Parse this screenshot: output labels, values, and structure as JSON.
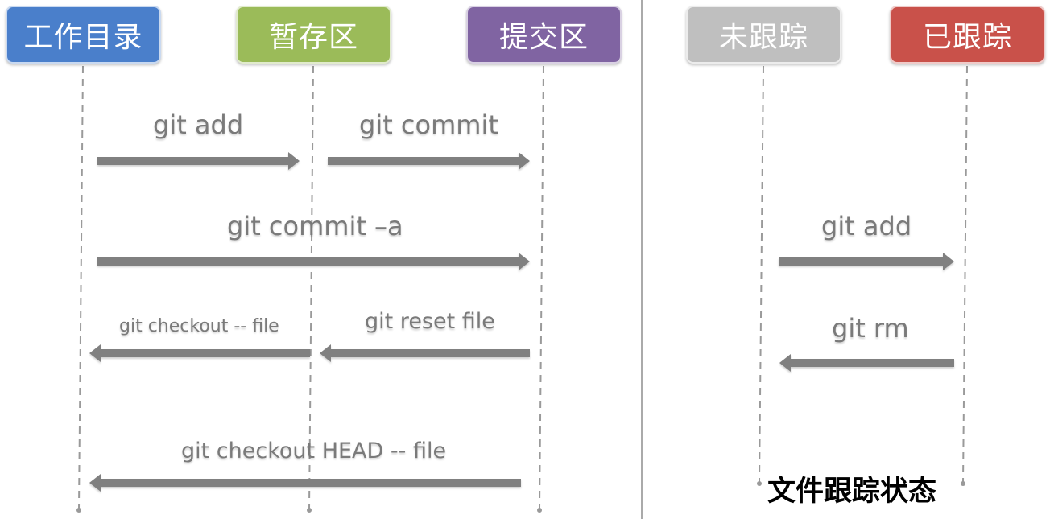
{
  "left_diagram": {
    "boxes": [
      {
        "label": "工作目录",
        "color": "#4a7fcb"
      },
      {
        "label": "暂存区",
        "color": "#9bbb59"
      },
      {
        "label": "提交区",
        "color": "#8064a2"
      }
    ],
    "commands": {
      "git_add": "git add",
      "git_commit": "git commit",
      "git_commit_a": "git commit –a",
      "git_checkout_file": "git checkout -- file",
      "git_reset_file": "git reset file",
      "git_checkout_head_file": "git checkout HEAD -- file"
    }
  },
  "right_diagram": {
    "boxes": [
      {
        "label": "未跟踪",
        "color": "#bfbfbf"
      },
      {
        "label": "已跟踪",
        "color": "#c9514a"
      }
    ],
    "commands": {
      "git_add": "git add",
      "git_rm": "git rm"
    },
    "caption": "文件跟踪状态"
  },
  "colors": {
    "arrow": "#808080",
    "lifeline": "#9a9a9a",
    "divider": "#555555",
    "command_text": "#7a7a7a"
  }
}
